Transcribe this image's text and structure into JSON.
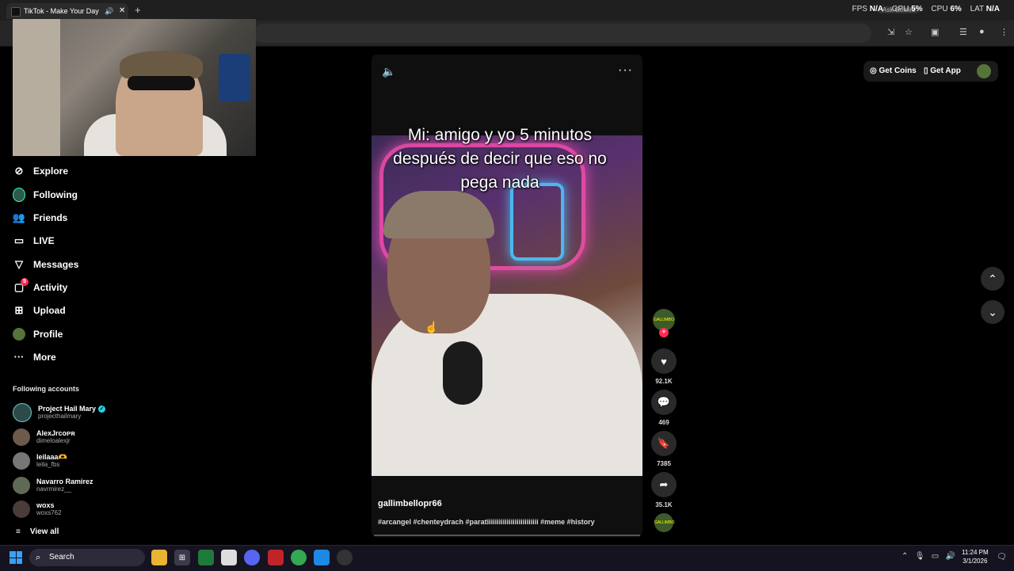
{
  "browser": {
    "tab_title": "TikTok - Make Your Day",
    "new_tab": "+",
    "gemini": "Ask Gemini",
    "perf": {
      "fps_label": "FPS",
      "fps_value": "N/A",
      "gpu_label": "GPU",
      "gpu_value": "5%",
      "cpu_label": "CPU",
      "cpu_value": "6%",
      "lat_label": "LAT",
      "lat_value": "N/A"
    }
  },
  "sidebar": {
    "items": [
      {
        "label": "Explore",
        "icon": "compass-icon"
      },
      {
        "label": "Following",
        "icon": "following-avatar-icon"
      },
      {
        "label": "Friends",
        "icon": "friends-icon"
      },
      {
        "label": "LIVE",
        "icon": "live-tv-icon"
      },
      {
        "label": "Messages",
        "icon": "send-icon"
      },
      {
        "label": "Activity",
        "icon": "activity-icon",
        "badge": "5"
      },
      {
        "label": "Upload",
        "icon": "upload-plus-icon"
      },
      {
        "label": "Profile",
        "icon": "profile-avatar-icon"
      },
      {
        "label": "More",
        "icon": "more-dots-icon"
      }
    ],
    "following_header": "Following accounts",
    "accounts": [
      {
        "name": "Project Hail Mary",
        "handle": "projecthailmary",
        "verified": true
      },
      {
        "name": "AlexJrᴄᴏᴘʀ",
        "handle": "dimeloalexjr",
        "verified": false
      },
      {
        "name": "leilaaa🫶",
        "handle": "leila_fbs",
        "verified": false
      },
      {
        "name": "Navarro Ramirez",
        "handle": "navrmirez__",
        "verified": false
      },
      {
        "name": "woxs",
        "handle": "woxs762",
        "verified": false
      }
    ],
    "view_all": "View all"
  },
  "video": {
    "caption": "Mi: amigo y yo 5 minutos después de decir que eso no pega nada",
    "author": "gallimbellopr66",
    "tags": "#arcangel #chenteydrach #paratiiiiiiiiiiiiiiiiiiiiiiiiii #meme #history",
    "creator_label": "GALLIMBO",
    "likes": "92.1K",
    "comments": "469",
    "saves": "7385",
    "shares": "35.1K"
  },
  "topright": {
    "get_coins": "Get Coins",
    "get_app": "Get App"
  },
  "taskbar": {
    "search": "Search",
    "time": "11:24 PM",
    "date": "3/1/2026"
  }
}
